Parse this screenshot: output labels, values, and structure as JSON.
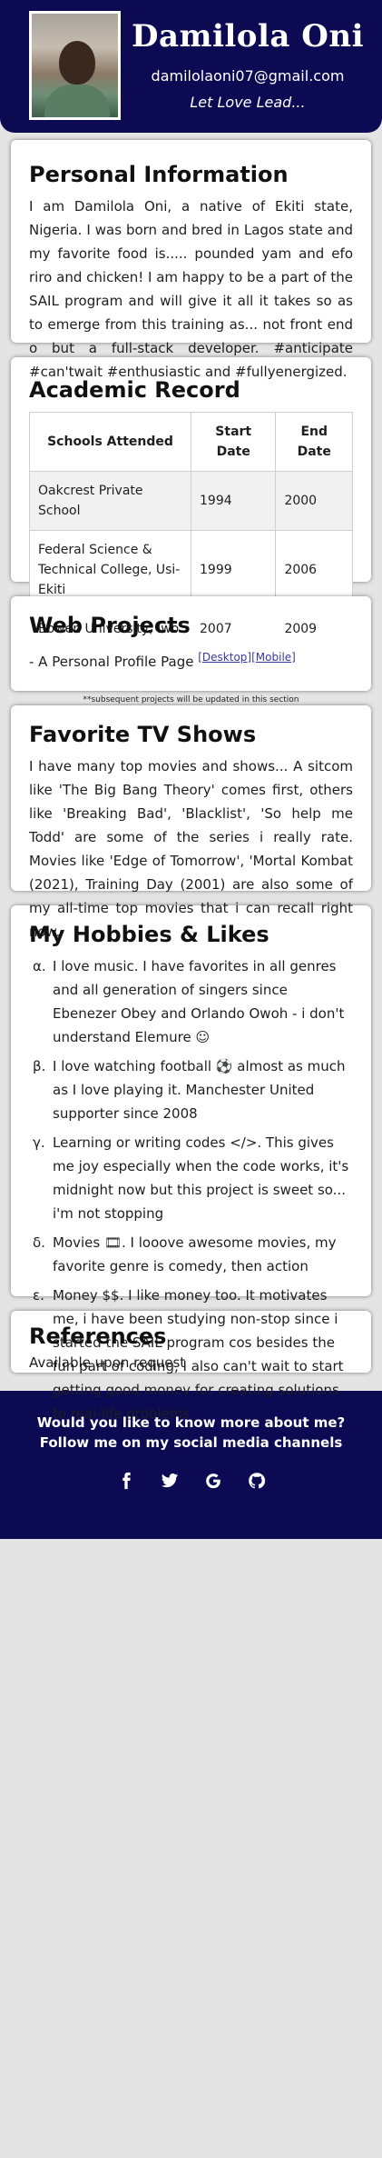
{
  "header": {
    "name": "Damilola Oni",
    "email": "damilolaoni07@gmail.com",
    "motto": "Let Love Lead..."
  },
  "personal": {
    "title": "Personal Information",
    "text": "I am Damilola Oni, a native of Ekiti state, Nigeria. I was born and bred in Lagos state and my favorite food is..... pounded yam and efo riro and chicken! I am happy to be a part of the SAIL program and will give it all it takes so as to emerge from this training as... not front end o but a full-stack developer. #anticipate #can'twait #enthusiastic and #fullyenergized."
  },
  "academic": {
    "title": "Academic Record",
    "headers": [
      "Schools Attended",
      "Start Date",
      "End Date"
    ],
    "rows": [
      [
        "Oakcrest Private School",
        "1994",
        "2000"
      ],
      [
        "Federal Science & Technical College, Usi-Ekiti",
        "1999",
        "2006"
      ],
      [
        "Bowen University, Iwo",
        "2007",
        "2009"
      ]
    ]
  },
  "projects": {
    "title": "Web Projects",
    "item": "- A Personal Profile Page",
    "desktop_link": "[Desktop]",
    "mobile_link": "[Mobile]",
    "note": "**subsequent projects will be updated in this section"
  },
  "tv": {
    "title": "Favorite TV Shows",
    "text": "I have many top movies and shows... A sitcom like 'The Big Bang Theory' comes first, others like 'Breaking Bad', 'Blacklist', 'So help me Todd' are some of the series i really rate. Movies like 'Edge of Tomorrow', 'Mortal Kombat (2021), Training Day (2001) are also some of my all-time top movies that i can recall right now."
  },
  "hobbies": {
    "title": "My Hobbies & Likes",
    "items": [
      {
        "marker": "α.",
        "text": "I love music. I have favorites in all genres and all generation of singers since Ebenezer Obey and Orlando Owoh - i don't understand Elemure ☺"
      },
      {
        "marker": "β.",
        "text": "I love watching football ⚽ almost as much as I love playing it. Manchester United supporter since 2008"
      },
      {
        "marker": "γ.",
        "text": "Learning or writing codes </>. This gives me joy especially when the code works, it's midnight now but this project is sweet so... i'm not stopping"
      },
      {
        "marker": "δ.",
        "text": "Movies 🎞. I looove awesome movies, my favorite genre is comedy, then action"
      },
      {
        "marker": "ε.",
        "text": "Money $$. I like money too. It motivates me, i have been studying non-stop since i started the SAIL program cos besides the fun part of coding, I also can't wait to start getting good money for creating solutions to real-life problems"
      }
    ]
  },
  "references": {
    "title": "References",
    "text": "Available upon request"
  },
  "footer": {
    "text": "Would you like to know more about me? Follow me on my social media channels",
    "icons": [
      "facebook-icon",
      "twitter-icon",
      "google-icon",
      "github-icon"
    ]
  },
  "colors": {
    "navy": "#0c0a52",
    "background": "#e4e4e4",
    "link": "#3a3a9a"
  }
}
